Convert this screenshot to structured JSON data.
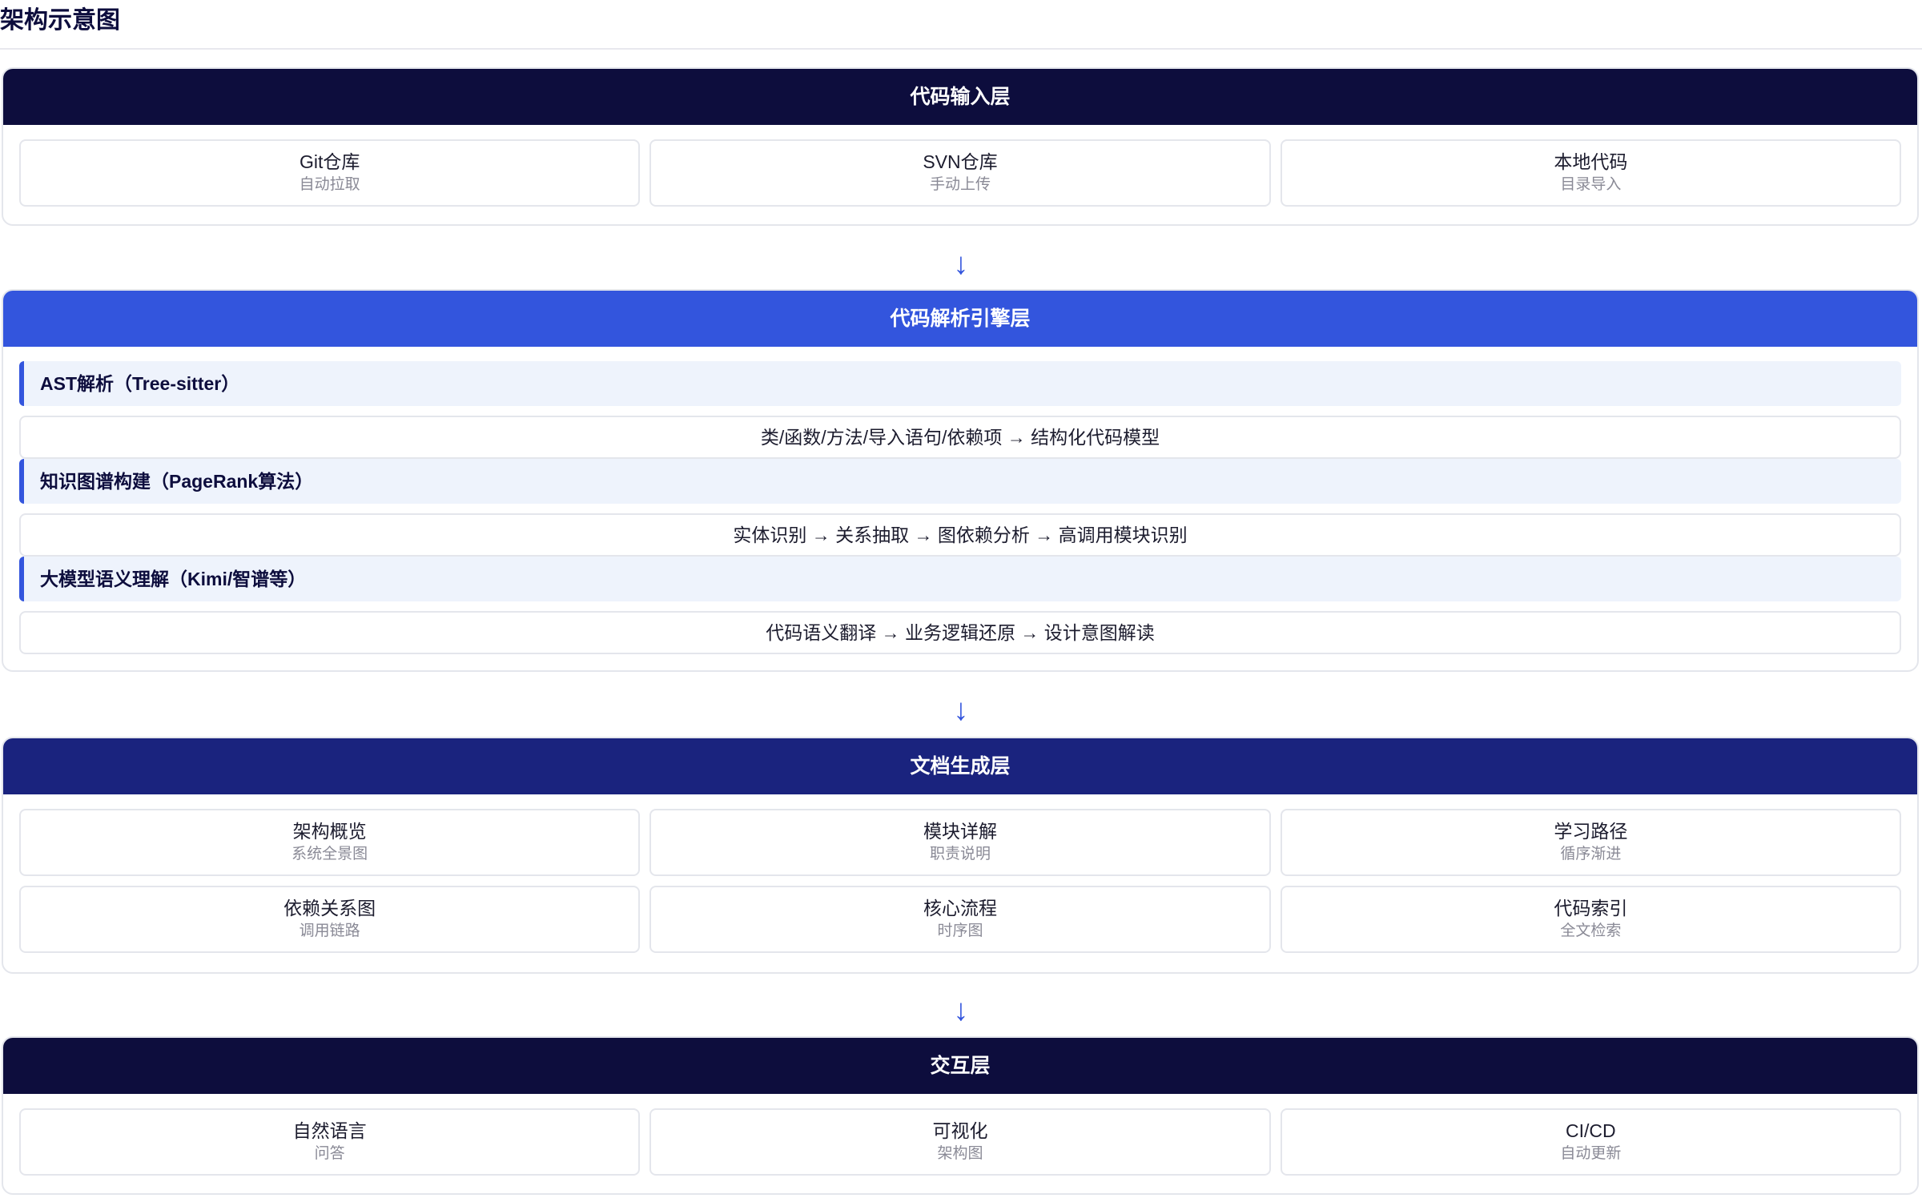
{
  "page": {
    "title": "架构示意图"
  },
  "colors": {
    "dark_navy": "#0d0d3d",
    "bright_blue": "#3355dd",
    "mid_navy": "#1a237e",
    "section_bg": "#eef3fc",
    "arrow": "#3355dd"
  },
  "arrow_glyph": "↓",
  "layers": [
    {
      "title": "代码输入层",
      "cards": [
        {
          "title": "Git仓库",
          "sub": "自动拉取"
        },
        {
          "title": "SVN仓库",
          "sub": "手动上传"
        },
        {
          "title": "本地代码",
          "sub": "目录导入"
        }
      ]
    },
    {
      "title": "代码解析引擎层",
      "sections": [
        {
          "label": "AST解析（Tree-sitter）",
          "flow": "类/函数/方法/导入语句/依赖项 → 结构化代码模型"
        },
        {
          "label": "知识图谱构建（PageRank算法）",
          "flow": "实体识别 → 关系抽取 → 图依赖分析 → 高调用模块识别"
        },
        {
          "label": "大模型语义理解（Kimi/智谱等）",
          "flow": "代码语义翻译 → 业务逻辑还原 → 设计意图解读"
        }
      ]
    },
    {
      "title": "文档生成层",
      "cards": [
        {
          "title": "架构概览",
          "sub": "系统全景图"
        },
        {
          "title": "模块详解",
          "sub": "职责说明"
        },
        {
          "title": "学习路径",
          "sub": "循序渐进"
        },
        {
          "title": "依赖关系图",
          "sub": "调用链路"
        },
        {
          "title": "核心流程",
          "sub": "时序图"
        },
        {
          "title": "代码索引",
          "sub": "全文检索"
        }
      ]
    },
    {
      "title": "交互层",
      "cards": [
        {
          "title": "自然语言",
          "sub": "问答"
        },
        {
          "title": "可视化",
          "sub": "架构图"
        },
        {
          "title": "CI/CD",
          "sub": "自动更新"
        }
      ]
    }
  ]
}
